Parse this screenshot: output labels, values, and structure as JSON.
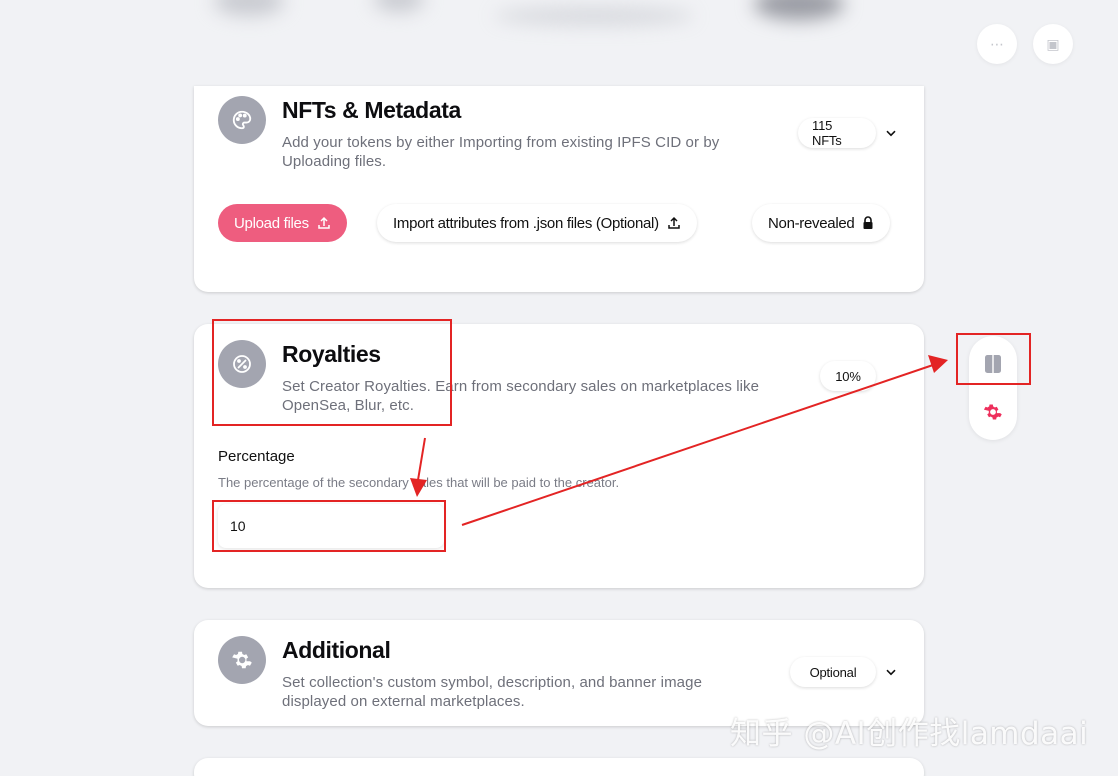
{
  "header_actions": {
    "more_icon_glyph": "⋯",
    "wallet_icon_glyph": "▣"
  },
  "nfts_card": {
    "title": "NFTs & Metadata",
    "description_line1": "Add your tokens by either Importing from existing IPFS CID or by",
    "description_line2": "Uploading files.",
    "count_badge": "115 NFTs",
    "upload_button": "Upload files",
    "import_button": "Import attributes from .json files (Optional)",
    "nonrevealed_button": "Non-revealed"
  },
  "royalties_card": {
    "title": "Royalties",
    "description_line1": "Set Creator Royalties. Earn from secondary sales on marketplaces like",
    "description_line2": "OpenSea, Blur, etc.",
    "badge": "10%",
    "field_label": "Percentage",
    "field_help": "The percentage of the secondary sales that will be paid to the creator.",
    "field_value": "10"
  },
  "additional_card": {
    "title": "Additional",
    "description_line1": "Set collection's custom symbol, description, and banner image",
    "description_line2": "displayed on external marketplaces.",
    "badge": "Optional"
  },
  "watermark": "知乎 @AI创作找lamdaai",
  "colors": {
    "accent": "#ee5d7f",
    "icon_circle": "#a3a5b0",
    "annotation_red": "#e32424",
    "background": "#f1f2f5"
  }
}
